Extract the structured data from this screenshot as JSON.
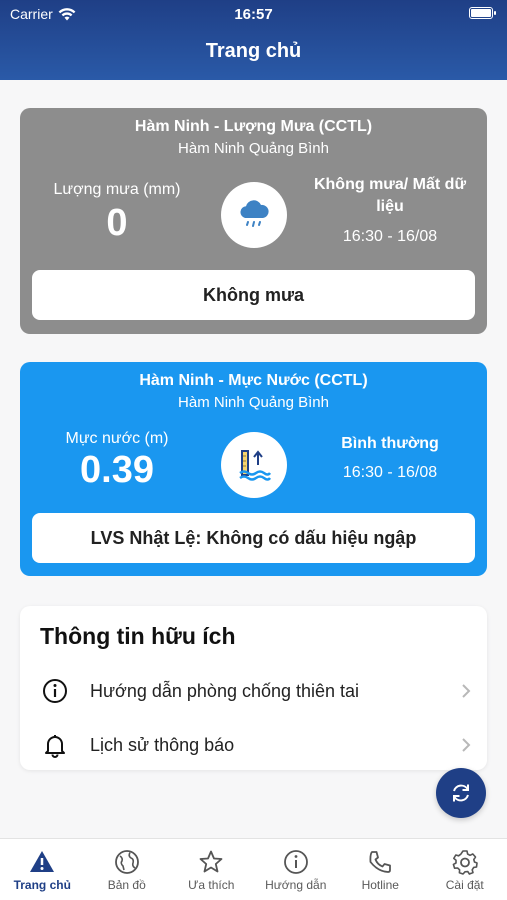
{
  "status_bar": {
    "carrier": "Carrier",
    "time": "16:57"
  },
  "header": {
    "title": "Trang chủ"
  },
  "rain_card": {
    "station": "Hàm Ninh - Lượng Mưa (CCTL)",
    "location": "Hàm Ninh Quảng Bình",
    "metric_label": "Lượng mưa (mm)",
    "value": "0",
    "status": "Không mưa/ Mất dữ liệu",
    "time": "16:30 - 16/08",
    "banner": "Không mưa",
    "icon": "rain-cloud-icon",
    "color": "#8d8d8d"
  },
  "water_card": {
    "station": "Hàm Ninh - Mực Nước (CCTL)",
    "location": "Hàm Ninh Quảng Bình",
    "metric_label": "Mực nước (m)",
    "value": "0.39",
    "status": "Bình thường",
    "time": "16:30 - 16/08",
    "banner": "LVS Nhật Lệ: Không có dấu hiệu ngập",
    "icon": "water-level-icon",
    "color": "#1a97f0"
  },
  "info": {
    "title": "Thông tin hữu ích",
    "items": [
      {
        "label": "Hướng dẫn phòng chống thiên tai",
        "icon": "info-icon"
      },
      {
        "label": "Lịch sử thông báo",
        "icon": "bell-icon"
      }
    ]
  },
  "tabs": [
    {
      "label": "Trang chủ",
      "icon": "warning-icon",
      "active": true
    },
    {
      "label": "Bản đồ",
      "icon": "globe-icon"
    },
    {
      "label": "Ưa thích",
      "icon": "star-icon"
    },
    {
      "label": "Hướng dẫn",
      "icon": "info-icon"
    },
    {
      "label": "Hotline",
      "icon": "phone-icon"
    },
    {
      "label": "Cài đặt",
      "icon": "gear-icon"
    }
  ],
  "colors": {
    "header": "#1f3f86",
    "accent": "#1f3f86"
  }
}
